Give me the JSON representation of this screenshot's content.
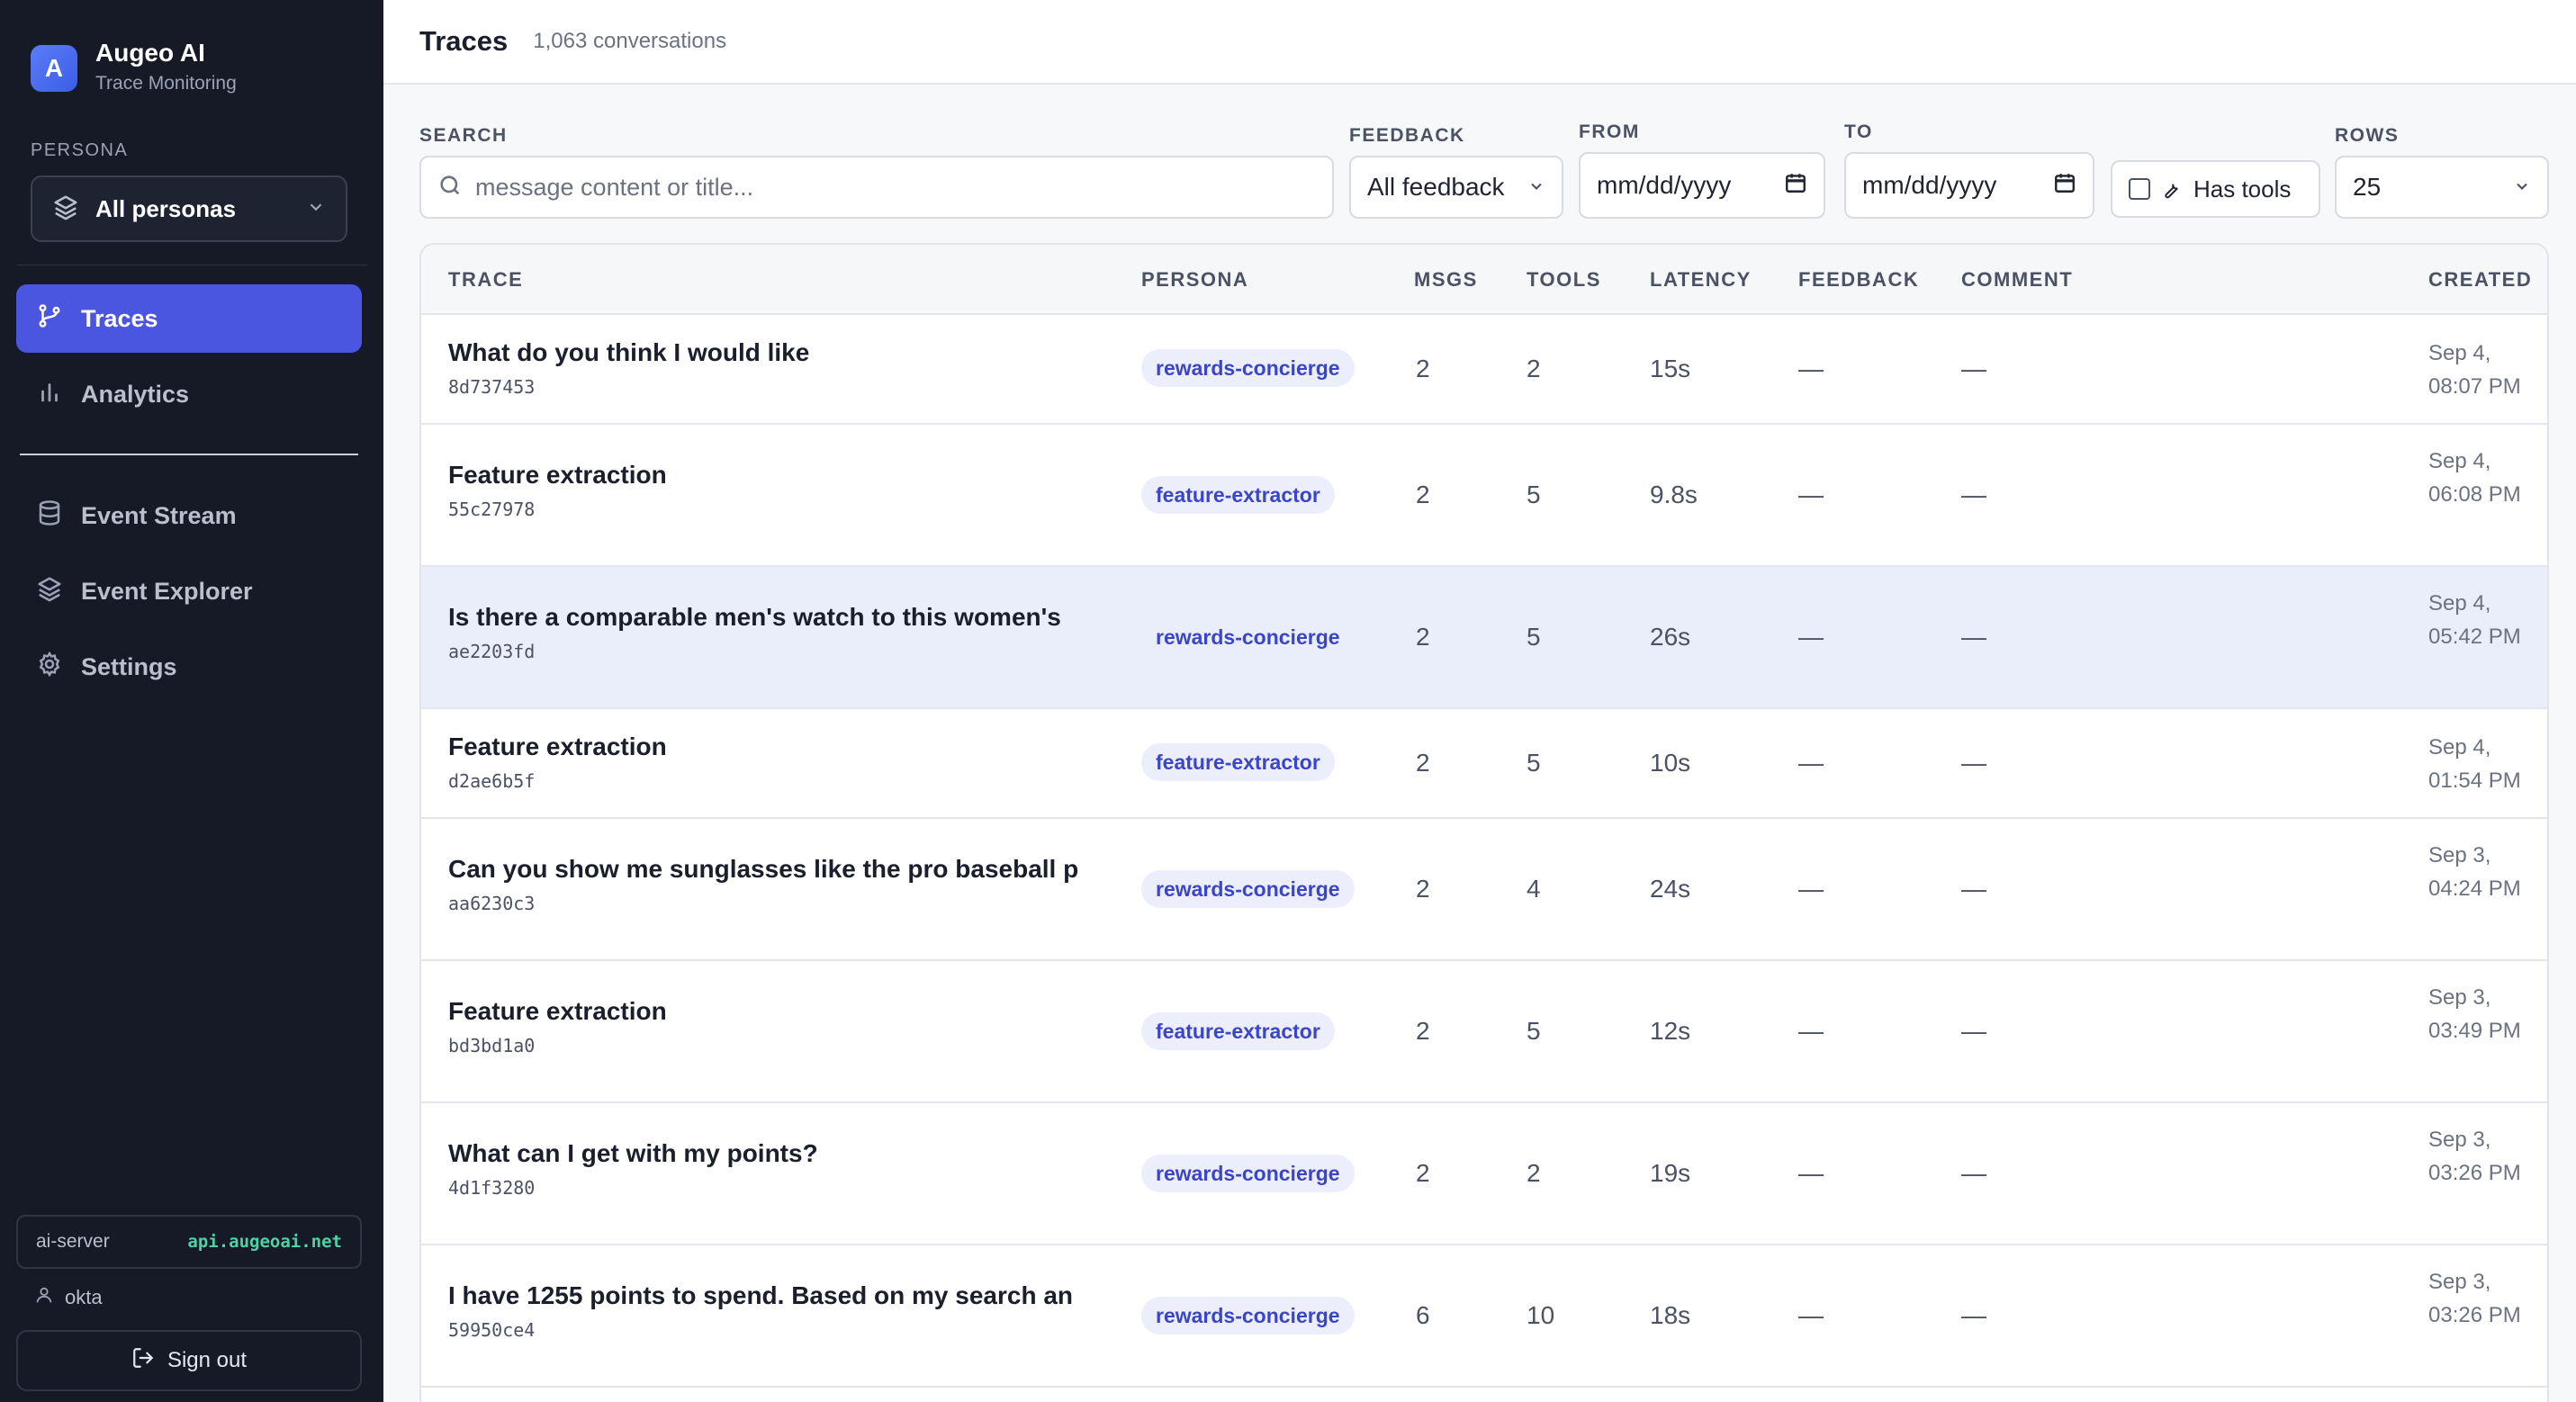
{
  "sidebar": {
    "brand": {
      "logo_letter": "A",
      "name": "Augeo AI",
      "subtitle": "Trace Monitoring"
    },
    "persona": {
      "label": "PERSONA",
      "value": "All personas"
    },
    "nav_primary": [
      {
        "label": "Traces",
        "icon": "branch-icon",
        "active": true
      },
      {
        "label": "Analytics",
        "icon": "bar-chart-icon",
        "active": false
      }
    ],
    "nav_secondary": [
      {
        "label": "Event Stream",
        "icon": "database-icon"
      },
      {
        "label": "Event Explorer",
        "icon": "layers-icon"
      },
      {
        "label": "Settings",
        "icon": "gear-icon"
      }
    ],
    "server": {
      "name": "ai-server",
      "host": "api.augeoai.net"
    },
    "user": "okta",
    "signout": "Sign out"
  },
  "header": {
    "title": "Traces",
    "count": "1,063 conversations"
  },
  "filters": {
    "search": {
      "label": "SEARCH",
      "placeholder": "message content or title..."
    },
    "feedback": {
      "label": "FEEDBACK",
      "value": "All feedback"
    },
    "from": {
      "label": "FROM",
      "value": "mm/dd/yyyy"
    },
    "to": {
      "label": "TO",
      "value": "mm/dd/yyyy"
    },
    "has_tools": {
      "label": "Has tools",
      "checked": false
    },
    "rows": {
      "label": "ROWS",
      "value": "25"
    }
  },
  "table": {
    "columns": [
      "TRACE",
      "PERSONA",
      "MSGS",
      "TOOLS",
      "LATENCY",
      "FEEDBACK",
      "COMMENT",
      "CREATED"
    ],
    "rows": [
      {
        "title": "What do you think I would like",
        "id": "8d737453",
        "persona": "rewards-concierge",
        "msgs": "2",
        "tools": "2",
        "latency": "15s",
        "feedback": "—",
        "comment": "—",
        "created": "Sep 4, 08:07 PM"
      },
      {
        "title": "Feature extraction",
        "id": "55c27978",
        "persona": "feature-extractor",
        "msgs": "2",
        "tools": "5",
        "latency": "9.8s",
        "feedback": "—",
        "comment": "—",
        "created": "Sep 4, 06:08 PM"
      },
      {
        "title": "Is there a comparable men's watch to this women's",
        "id": "ae2203fd",
        "persona": "rewards-concierge",
        "msgs": "2",
        "tools": "5",
        "latency": "26s",
        "feedback": "—",
        "comment": "—",
        "created": "Sep 4, 05:42 PM"
      },
      {
        "title": "Feature extraction",
        "id": "d2ae6b5f",
        "persona": "feature-extractor",
        "msgs": "2",
        "tools": "5",
        "latency": "10s",
        "feedback": "—",
        "comment": "—",
        "created": "Sep 4, 01:54 PM"
      },
      {
        "title": "Can you show me sunglasses like the pro baseball p",
        "id": "aa6230c3",
        "persona": "rewards-concierge",
        "msgs": "2",
        "tools": "4",
        "latency": "24s",
        "feedback": "—",
        "comment": "—",
        "created": "Sep 3, 04:24 PM"
      },
      {
        "title": "Feature extraction",
        "id": "bd3bd1a0",
        "persona": "feature-extractor",
        "msgs": "2",
        "tools": "5",
        "latency": "12s",
        "feedback": "—",
        "comment": "—",
        "created": "Sep 3, 03:49 PM"
      },
      {
        "title": "What can I get with my points?",
        "id": "4d1f3280",
        "persona": "rewards-concierge",
        "msgs": "2",
        "tools": "2",
        "latency": "19s",
        "feedback": "—",
        "comment": "—",
        "created": "Sep 3, 03:26 PM"
      },
      {
        "title": "I have 1255 points to spend. Based on my search an",
        "id": "59950ce4",
        "persona": "rewards-concierge",
        "msgs": "6",
        "tools": "10",
        "latency": "18s",
        "feedback": "—",
        "comment": "—",
        "created": "Sep 3, 03:26 PM"
      }
    ]
  }
}
